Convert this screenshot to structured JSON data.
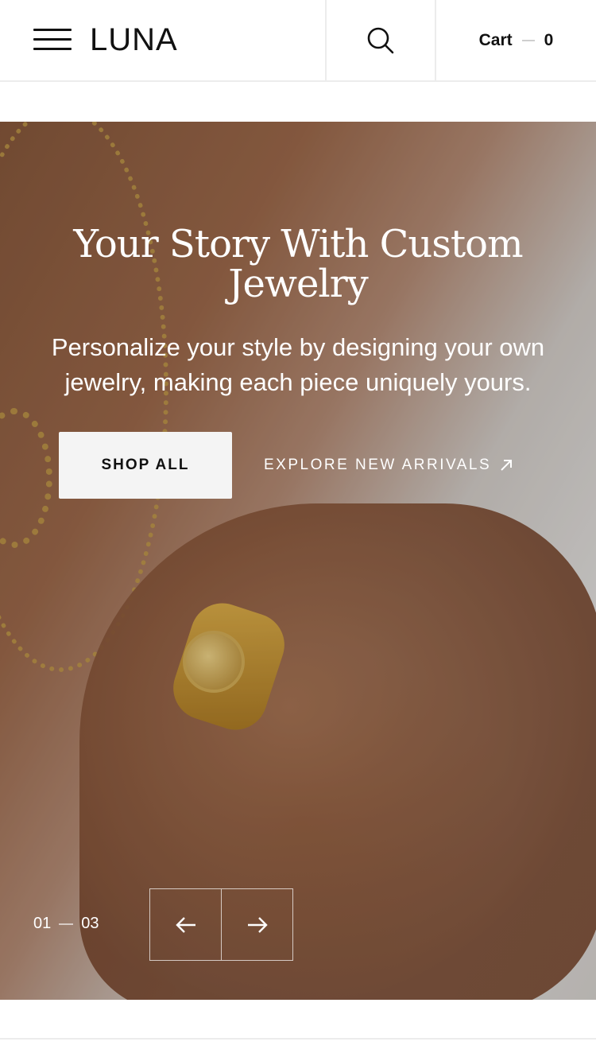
{
  "header": {
    "logo": "LUNA",
    "cart_label": "Cart",
    "cart_count": "0",
    "icons": {
      "menu": "hamburger-menu-icon",
      "search": "search-icon"
    }
  },
  "hero": {
    "title_line1": "Your Story With Custom",
    "title_line2": "Jewelry",
    "subtitle_line1": "Personalize your style by designing your own",
    "subtitle_line2": "jewelry, making each piece uniquely yours.",
    "primary_button": "SHOP ALL",
    "secondary_link": "EXPLORE NEW ARRIVALS",
    "slide_current": "01",
    "slide_total": "03",
    "icons": {
      "prev": "arrow-left-icon",
      "next": "arrow-right-icon",
      "link": "arrow-up-right-icon"
    }
  },
  "colors": {
    "accent": "#111111",
    "button_bg": "#f4f4f4",
    "hero_text": "#ffffff"
  }
}
